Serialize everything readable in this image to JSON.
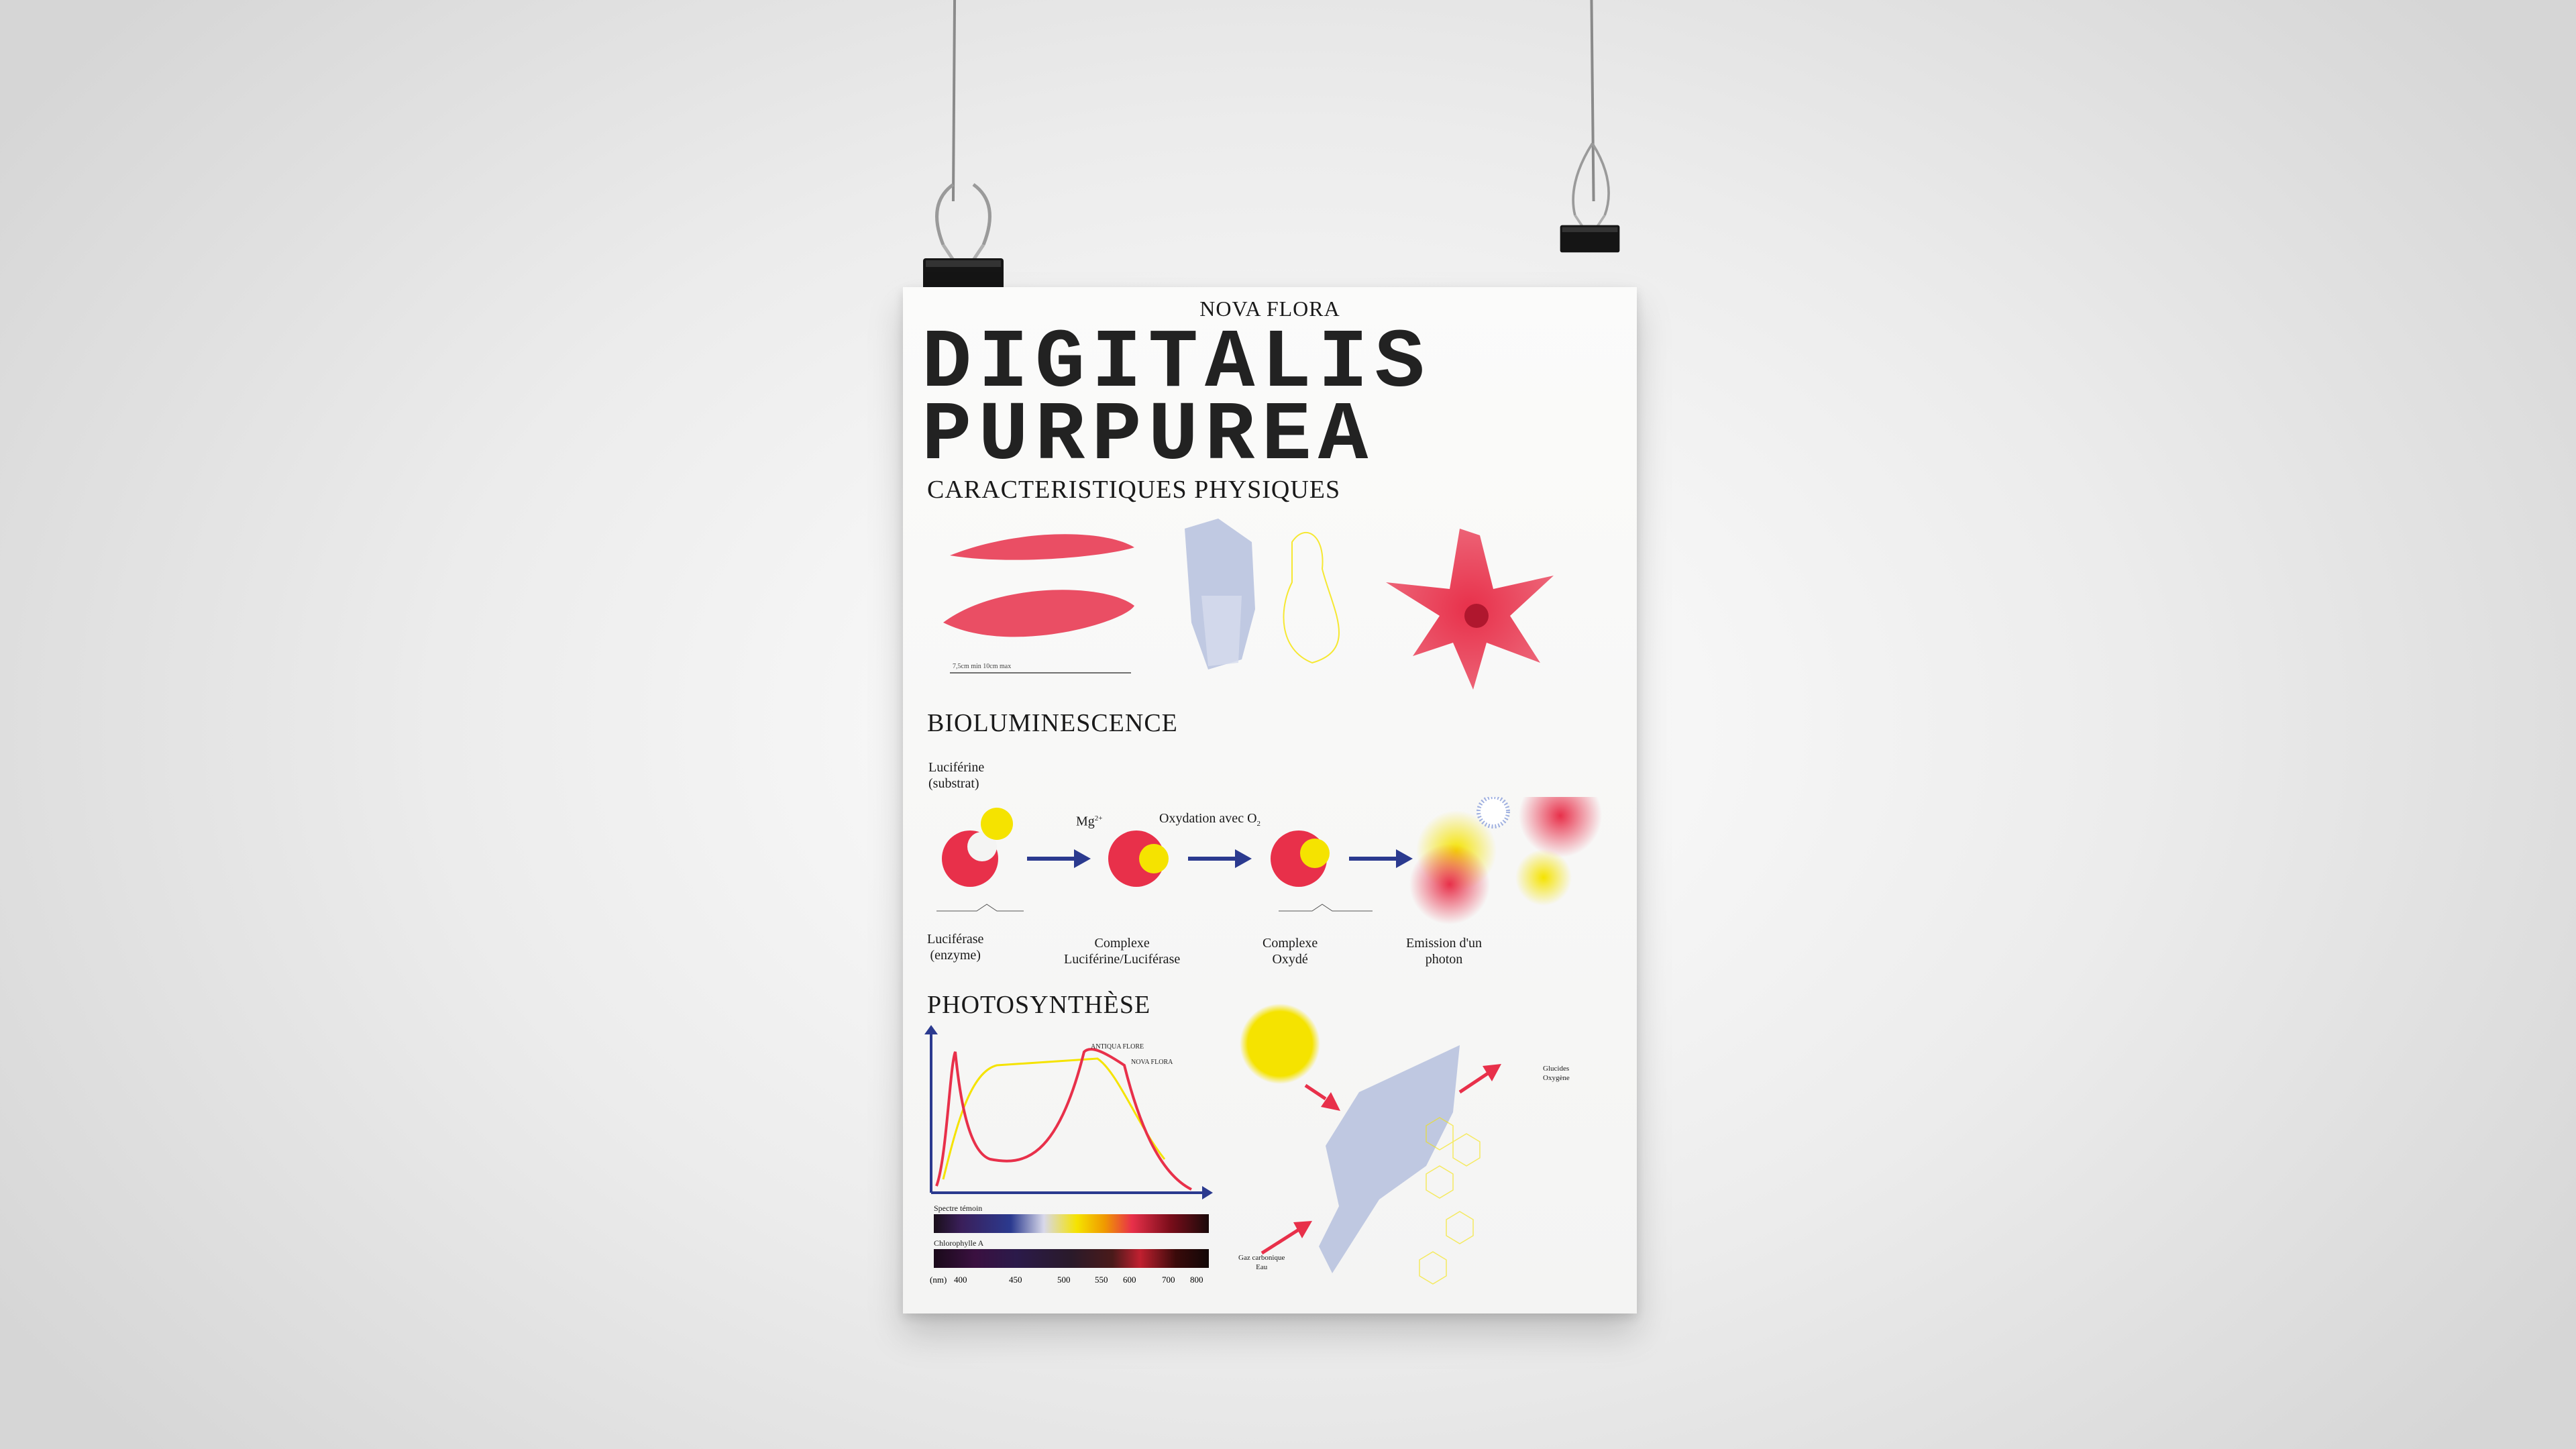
{
  "poster": {
    "brand": "NOVA FLORA",
    "title_line1": "DIGITALIS",
    "title_line2": "PURPUREA",
    "section_physical": "CARACTERISTIQUES PHYSIQUES",
    "section_biolum": "BIOLUMINESCENCE",
    "section_photo": "PHOTOSYNTHÈSE",
    "scale_note": "7,5cm min 10cm max",
    "biolum": {
      "substrate_line1": "Luciférine",
      "substrate_line2": "(substrat)",
      "enzyme_line1": "Luciférase",
      "enzyme_line2": "(enzyme)",
      "mg_label": "Mg",
      "mg_sup": "2+",
      "oxidation_label": "Oxydation avec O",
      "oxidation_sub": "2",
      "complex1_line1": "Complexe",
      "complex1_line2": "Luciférine/Luciférase",
      "complex2_line1": "Complexe",
      "complex2_line2": "Oxydé",
      "emission_line1": "Emission d'un",
      "emission_line2": "photon"
    },
    "photo": {
      "curve_antiqua": "ANTIQUA FLORE",
      "curve_nova": "NOVA FLORA",
      "spectre_label": "Spectre témoin",
      "chloro_label": "Chlorophylle A",
      "unit": "(nm)",
      "ticks": [
        "400",
        "450",
        "500",
        "550",
        "600",
        "700",
        "800"
      ],
      "output_line1": "Glucides",
      "output_line2": "Oxygène",
      "input_line1": "Gaz carbonique",
      "input_line2": "Eau"
    }
  },
  "colors": {
    "red": "#e8304a",
    "yellow": "#f5e300",
    "blue": "#2b3a8f",
    "pale_blue": "#b9c3df"
  }
}
